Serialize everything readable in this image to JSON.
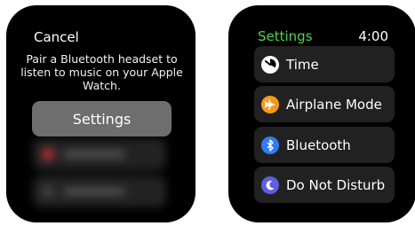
{
  "left_screen": {
    "cancel_label": "Cancel",
    "message": "Pair a Bluetooth headset to listen to music on your Apple Watch.",
    "settings_button_label": "Settings"
  },
  "right_screen": {
    "title": "Settings",
    "time": "4:00",
    "title_color": "#52d24c",
    "items": [
      {
        "label": "Time",
        "icon": "clock-icon",
        "icon_color": "#ffffff"
      },
      {
        "label": "Airplane Mode",
        "icon": "airplane-icon",
        "icon_color": "#f39a1e"
      },
      {
        "label": "Bluetooth",
        "icon": "bluetooth-icon",
        "icon_color": "#2f7cf6"
      },
      {
        "label": "Do Not Disturb",
        "icon": "moon-icon",
        "icon_color": "#5b5fe0"
      }
    ]
  }
}
